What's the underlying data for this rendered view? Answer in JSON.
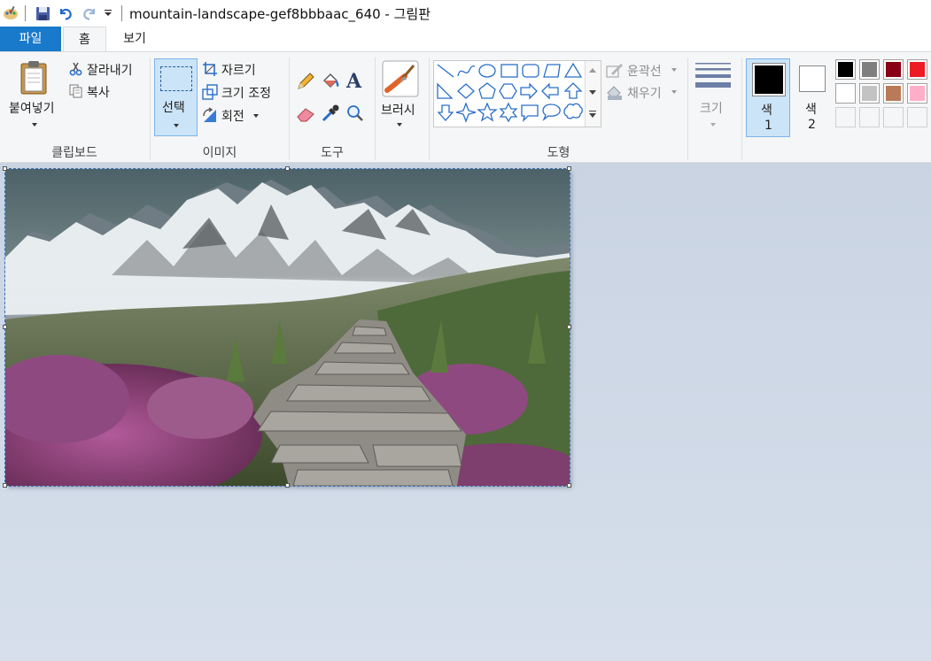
{
  "titlebar": {
    "title": "mountain-landscape-gef8bbbaac_640 - 그림판",
    "quick_access": [
      "paint-app-icon",
      "save-icon",
      "undo-icon",
      "redo-icon",
      "customize-dropdown-icon"
    ]
  },
  "tabs": [
    {
      "label": "파일"
    },
    {
      "label": "홈"
    },
    {
      "label": "보기"
    }
  ],
  "ribbon": {
    "clipboard": {
      "paste_label": "붙여넣기",
      "cut_label": "잘라내기",
      "copy_label": "복사",
      "group_label": "클립보드"
    },
    "image": {
      "select_label": "선택",
      "crop_label": "자르기",
      "resize_label": "크기 조정",
      "rotate_label": "회전",
      "group_label": "이미지"
    },
    "tools": {
      "group_label": "도구",
      "items": [
        "pencil-icon",
        "fill-icon",
        "text-icon",
        "eraser-icon",
        "color-picker-icon",
        "magnifier-icon"
      ]
    },
    "brushes": {
      "label": "브러시"
    },
    "shapes": {
      "group_label": "도형",
      "outline_label": "윤곽선",
      "fill_label": "채우기"
    },
    "size": {
      "label": "크기"
    },
    "colors": {
      "color1_label": "색",
      "color1_num": "1",
      "color2_label": "색",
      "color2_num": "2",
      "color1": "#000000",
      "color2": "#ffffff",
      "palette": [
        "#000000",
        "#7f7f7f",
        "#880015",
        "#ed1c24",
        "#ffffff",
        "#c3c3c3",
        "#b97a57",
        "#ffaec9",
        "",
        "",
        "",
        ""
      ]
    }
  },
  "canvas": {
    "image_description_icon": "mountain-landscape-image"
  },
  "colors": {
    "accent": "#1979ca",
    "ribbon_bg": "#f5f6f7",
    "selected_bg": "#cce4f7",
    "workspace": "#cbd5e4"
  }
}
